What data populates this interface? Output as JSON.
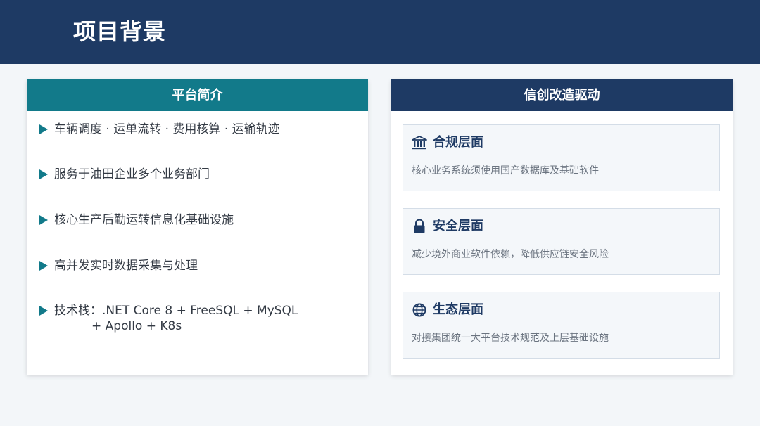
{
  "header": {
    "title": "项目背景"
  },
  "platform_card": {
    "title": "平台简介",
    "items": [
      {
        "lines": [
          "车辆调度 · 运单流转 · 费用核算 · 运输轨迹"
        ]
      },
      {
        "lines": [
          "服务于油田企业多个业务部门"
        ]
      },
      {
        "lines": [
          "核心生产后勤运转信息化基础设施"
        ]
      },
      {
        "lines": [
          "高并发实时数据采集与处理"
        ]
      },
      {
        "lines": [
          "技术栈：.NET Core 8 + FreeSQL + MySQL",
          "+ Apollo + K8s"
        ]
      }
    ]
  },
  "xinchuang_card": {
    "title": "信创改造驱动",
    "sections": [
      {
        "icon": "government-building-icon",
        "title": "合规层面",
        "desc": "核心业务系统须使用国产数据库及基础软件"
      },
      {
        "icon": "lock-icon",
        "title": "安全层面",
        "desc": "减少境外商业软件依赖，降低供应链安全风险"
      },
      {
        "icon": "globe-icon",
        "title": "生态层面",
        "desc": "对接集团统一大平台技术规范及上层基础设施"
      }
    ]
  },
  "colors": {
    "header_bg": "#1e3a64",
    "teal_accent": "#127a8a",
    "navy_accent": "#1e3a64",
    "page_bg": "#f3f6f9"
  }
}
